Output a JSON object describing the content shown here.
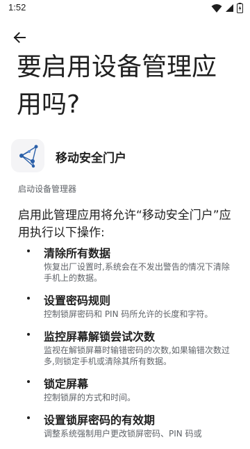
{
  "status_bar": {
    "time": "1:52",
    "icons": [
      "wifi-icon",
      "cellular-signal-icon",
      "battery-charging-icon"
    ]
  },
  "page": {
    "title": "要启用设备管理应用吗?"
  },
  "app": {
    "name": "移动安全门户",
    "description": "启动设备管理器"
  },
  "intro": "启用此管理应用将允许“移动安全门户”应用执行以下操作:",
  "permissions": [
    {
      "title": "清除所有数据",
      "desc": "恢复出厂设置时,系统会在不发出警告的情况下清除手机上的数据。"
    },
    {
      "title": "设置密码规则",
      "desc": "控制锁屏密码和 PIN 码所允许的长度和字符。"
    },
    {
      "title": "监控屏幕解锁尝试次数",
      "desc": "监视在解锁屏幕时输错密码的次数,如果输错次数过多,则锁定手机或清除其所有数据。"
    },
    {
      "title": "锁定屏幕",
      "desc": "控制锁屏的方式和时间。"
    },
    {
      "title": "设置锁屏密码的有效期",
      "desc": "调整系统强制用户更改锁屏密码、PIN 码或"
    }
  ],
  "colors": {
    "background": "#ffffff",
    "primary_text": "#1f1f1f",
    "secondary_text": "#5f6368",
    "accent": "#1a73e8"
  }
}
